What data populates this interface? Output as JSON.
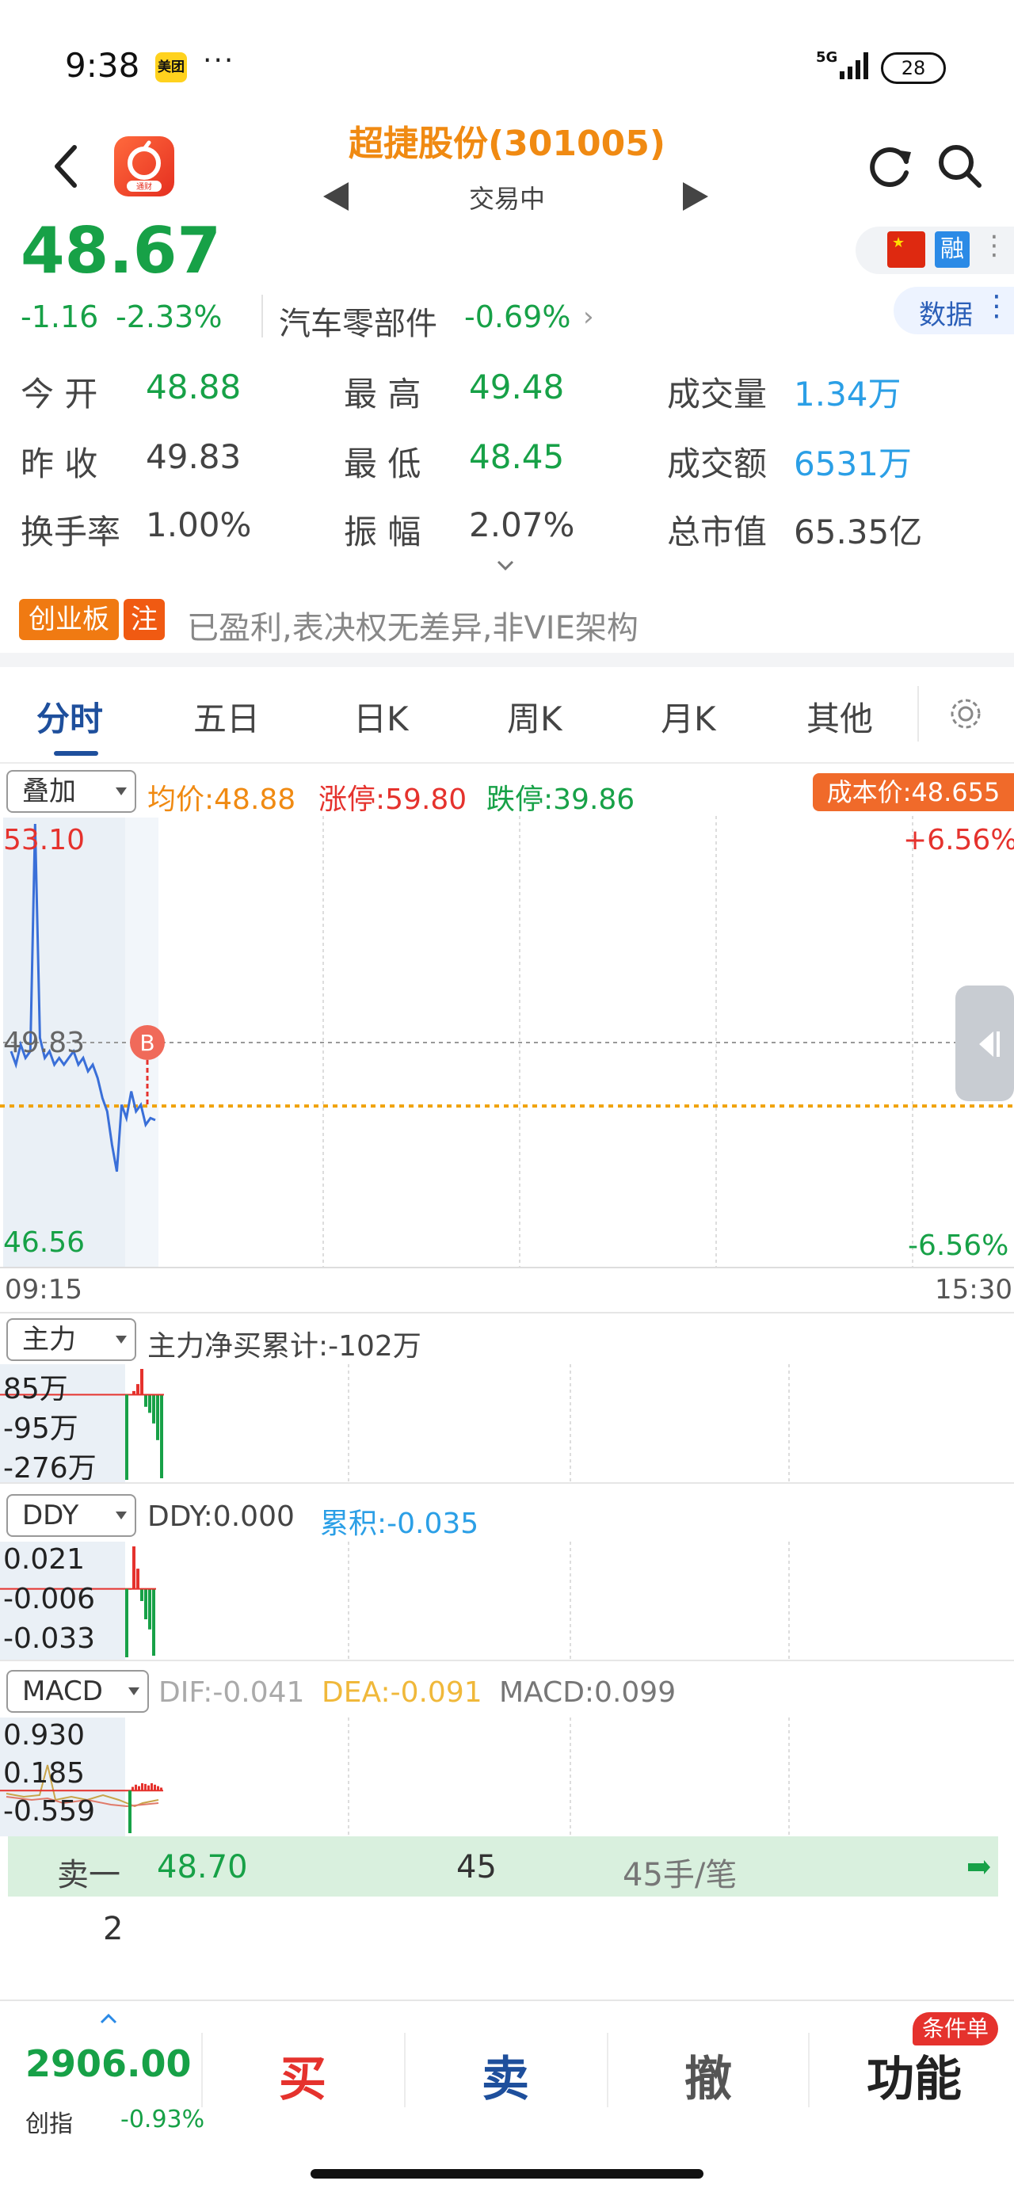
{
  "status_bar": {
    "time": "9:38",
    "app_badge": "美团",
    "dots": "···",
    "network": "5G",
    "battery": "28"
  },
  "header": {
    "title": "超捷股份(301005)",
    "status": "交易中",
    "logo_text": "通财"
  },
  "quote": {
    "price": "48.67",
    "change": "-1.16",
    "change_pct": "-2.33%",
    "sector_name": "汽车零部件",
    "sector_pct": "-0.69%",
    "flag_label": "融",
    "data_label": "数据",
    "open_label": "今  开",
    "open": "48.88",
    "prev_label": "昨  收",
    "prev": "49.83",
    "turnover_label": "换手率",
    "turnover": "1.00%",
    "high_label": "最  高",
    "high": "49.48",
    "low_label": "最  低",
    "low": "48.45",
    "amp_label": "振  幅",
    "amp": "2.07%",
    "vol_label": "成交量",
    "volume": "1.34万",
    "amt_label": "成交额",
    "amount": "6531万",
    "cap_label": "总市值",
    "mktcap": "65.35亿"
  },
  "board": {
    "tag": "创业板",
    "note_tag": "注",
    "desc": "已盈利,表决权无差异,非VIE架构"
  },
  "tabs": [
    "分时",
    "五日",
    "日K",
    "周K",
    "月K",
    "其他"
  ],
  "overlay": {
    "select": "叠加",
    "avg": "均价:48.88",
    "limit_up": "涨停:59.80",
    "limit_down": "跌停:39.86",
    "cost": "成本价:48.655"
  },
  "chart_data": [
    {
      "type": "line",
      "title": "",
      "x_start": "09:15",
      "x_end": "15:30",
      "ylim": [
        46.56,
        53.1
      ],
      "y_top_label": "53.10",
      "y_mid_label": "49.83",
      "y_bottom_label": "46.56",
      "pct_top": "+6.56%",
      "pct_bottom": "-6.56%",
      "prev_close": 49.83,
      "avg_price": 48.88,
      "trade_marker": "B",
      "series": [
        {
          "values": [
            49.7,
            49.5,
            49.8,
            49.6,
            49.7,
            53.1,
            49.9,
            49.6,
            49.7,
            49.5,
            49.6,
            49.5,
            49.6,
            49.7,
            49.5,
            49.6,
            49.4,
            49.5,
            49.3,
            49.0,
            48.8,
            48.3,
            47.9,
            48.9,
            48.7,
            49.1,
            48.8,
            48.9,
            48.6,
            48.7,
            48.67
          ]
        }
      ]
    },
    {
      "type": "bar",
      "indicator": "主力",
      "label": "主力净买累计:-102万",
      "y_labels": [
        "85万",
        "-95万",
        "-276万"
      ],
      "ylim": [
        -276,
        85
      ],
      "values": [
        0,
        12,
        35,
        85,
        -40,
        -60,
        -95,
        -150,
        -276
      ]
    },
    {
      "type": "bar",
      "indicator": "DDY",
      "ddy": "DDY:0.000",
      "cum": "累积:-0.035",
      "y_labels": [
        "0.021",
        "-0.006",
        "-0.033"
      ],
      "ylim": [
        -0.033,
        0.021
      ],
      "values": [
        0,
        0.021,
        0.01,
        -0.006,
        -0.015,
        -0.02,
        -0.033
      ]
    },
    {
      "type": "bar",
      "indicator": "MACD",
      "dif": "DIF:-0.041",
      "dea": "DEA:-0.091",
      "macd": "MACD:0.099",
      "y_labels": [
        "0.930",
        "0.185",
        "-0.559"
      ],
      "ylim": [
        -0.559,
        0.93
      ],
      "values": [
        0.05,
        0.08,
        0.06,
        0.1,
        0.09,
        0.07,
        0.1,
        0.08,
        0.06,
        0.04
      ]
    }
  ],
  "orderbook": {
    "label": "卖一",
    "price": "48.70",
    "volume": "45",
    "per_trade": "45手/笔",
    "count": "2"
  },
  "bottom": {
    "index_value": "2906.00",
    "index_name": "创指",
    "index_pct": "-0.93%",
    "buy": "买",
    "sell": "卖",
    "cancel": "撤",
    "func": "功能",
    "cond_badge": "条件单"
  }
}
